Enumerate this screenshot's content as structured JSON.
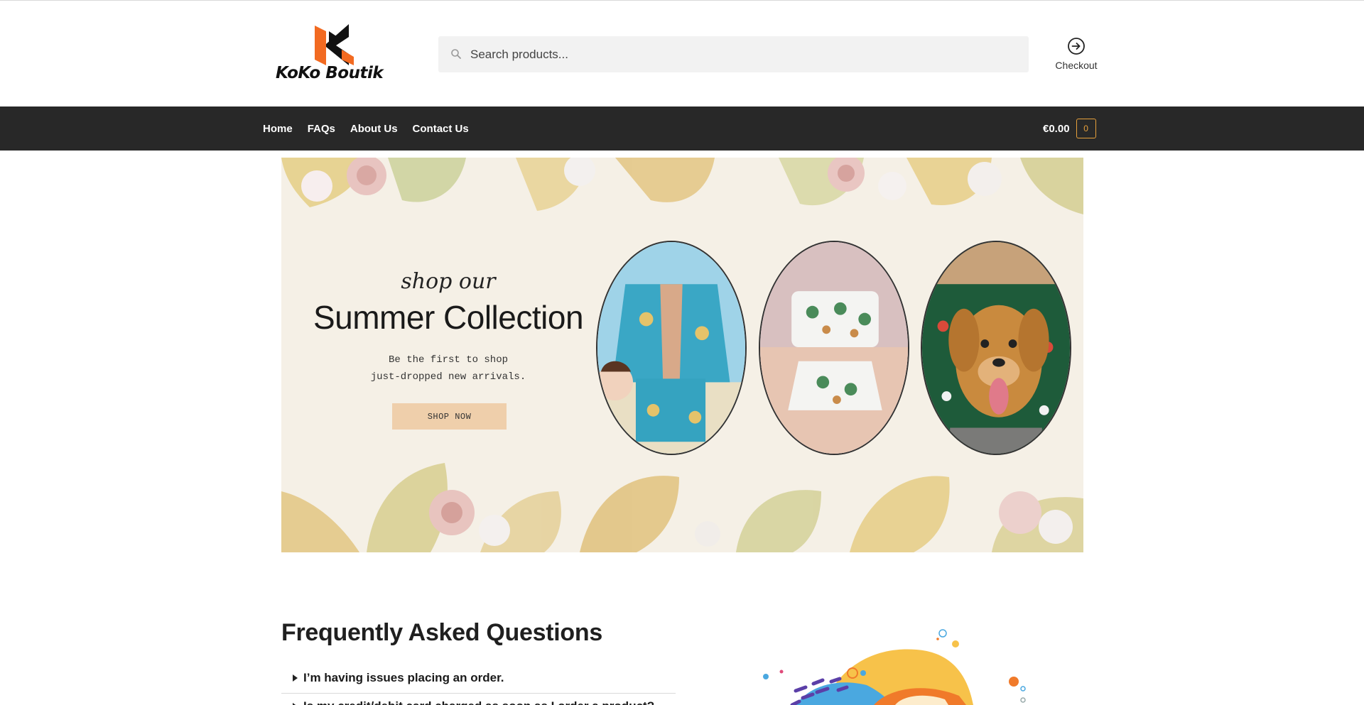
{
  "header": {
    "logo_text": "KoKo Boutik",
    "search_placeholder": "Search products...",
    "checkout_label": "Checkout"
  },
  "nav": {
    "items": [
      {
        "label": "Home"
      },
      {
        "label": "FAQs"
      },
      {
        "label": "About Us"
      },
      {
        "label": "Contact Us"
      }
    ],
    "cart_amount": "€0.00",
    "cart_count": "0"
  },
  "hero": {
    "script_text": "shop our",
    "title": "Summer Collection",
    "subtitle": "Be the first to shop\njust-dropped new arrivals.",
    "button_label": "SHOP NOW"
  },
  "faq": {
    "title": "Frequently Asked Questions",
    "items": [
      {
        "question": "I’m having issues placing an order."
      },
      {
        "question": "Is my credit/debit card charged as soon as I order a product?"
      }
    ]
  },
  "colors": {
    "nav_bg": "#282828",
    "accent_orange": "#e7a13c",
    "logo_orange": "#f26a21",
    "button_peach": "#efcfab",
    "hero_bg": "#f5f0e6"
  },
  "icons": [
    "search-icon",
    "arrow-circle-right-icon",
    "logo-mark-icon",
    "disclosure-triangle-icon"
  ]
}
